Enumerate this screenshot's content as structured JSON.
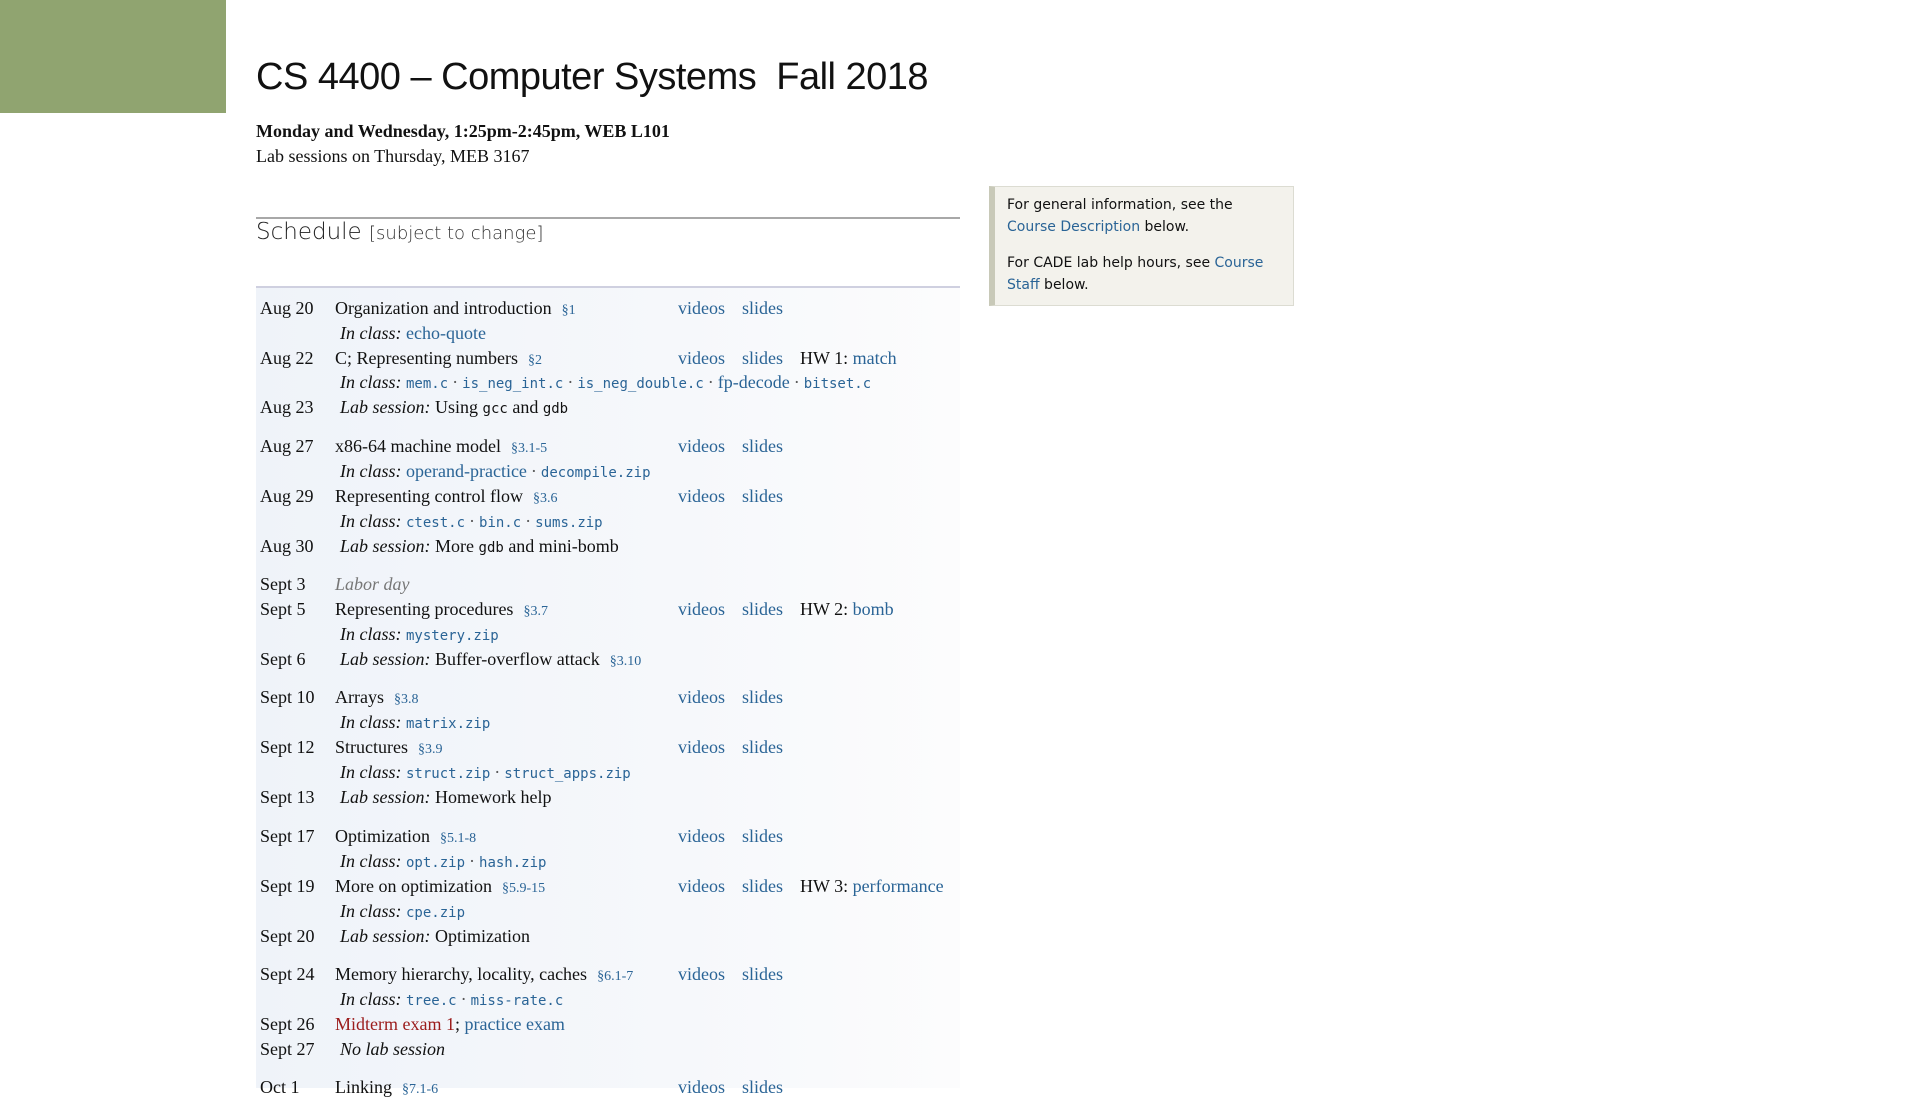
{
  "header": {
    "course_title": "CS 4400 – Computer Systems",
    "term": "Fall 2018",
    "meeting": "Monday and Wednesday, 1:25pm-2:45pm, WEB L101",
    "lab": "Lab sessions on Thursday, MEB 3167"
  },
  "schedule": {
    "heading": "Schedule",
    "subheading": "[subject to change]",
    "labels": {
      "in_class": "In class:",
      "lab_session": "Lab session:",
      "videos": "videos",
      "slides": "slides",
      "sep": "·"
    },
    "rows": {
      "aug20": {
        "date": "Aug 20",
        "topic": "Organization and introduction",
        "section": "§1",
        "in_class": [
          "echo-quote"
        ]
      },
      "aug22": {
        "date": "Aug 22",
        "topic": "C; Representing numbers",
        "section": "§2",
        "hw_label": "HW 1:",
        "hw_link": "match",
        "in_class": [
          "mem.c",
          "is_neg_int.c",
          "is_neg_double.c",
          "fp-decode",
          "bitset.c"
        ]
      },
      "aug23": {
        "date": "Aug 23",
        "lab_pre": "Using ",
        "lab_code1": "gcc",
        "lab_mid": " and ",
        "lab_code2": "gdb"
      },
      "aug27": {
        "date": "Aug 27",
        "topic": "x86-64 machine model",
        "section": "§3.1-5",
        "in_class": [
          "operand-practice",
          "decompile.zip"
        ]
      },
      "aug29": {
        "date": "Aug 29",
        "topic": "Representing control flow",
        "section": "§3.6",
        "in_class": [
          "ctest.c",
          "bin.c",
          "sums.zip"
        ]
      },
      "aug30": {
        "date": "Aug 30",
        "lab_pre": "More ",
        "lab_code1": "gdb",
        "lab_post": " and mini-bomb"
      },
      "sep3": {
        "date": "Sept 3",
        "note": "Labor day"
      },
      "sep5": {
        "date": "Sept 5",
        "topic": "Representing procedures",
        "section": "§3.7",
        "hw_label": "HW 2:",
        "hw_link": "bomb",
        "in_class": [
          "mystery.zip"
        ]
      },
      "sep6": {
        "date": "Sept 6",
        "lab_text": "Buffer-overflow attack",
        "section": "§3.10"
      },
      "sep10": {
        "date": "Sept 10",
        "topic": "Arrays",
        "section": "§3.8",
        "in_class": [
          "matrix.zip"
        ]
      },
      "sep12": {
        "date": "Sept 12",
        "topic": "Structures",
        "section": "§3.9",
        "in_class": [
          "struct.zip",
          "struct_apps.zip"
        ]
      },
      "sep13": {
        "date": "Sept 13",
        "lab_text": "Homework help"
      },
      "sep17": {
        "date": "Sept 17",
        "topic": "Optimization",
        "section": "§5.1-8",
        "in_class": [
          "opt.zip",
          "hash.zip"
        ]
      },
      "sep19": {
        "date": "Sept 19",
        "topic": "More on optimization",
        "section": "§5.9-15",
        "hw_label": "HW 3:",
        "hw_link": "performance",
        "in_class": [
          "cpe.zip"
        ]
      },
      "sep20": {
        "date": "Sept 20",
        "lab_text": "Optimization"
      },
      "sep24": {
        "date": "Sept 24",
        "topic": "Memory hierarchy, locality, caches",
        "section": "§6.1-7",
        "in_class": [
          "tree.c",
          "miss-rate.c"
        ]
      },
      "sep26": {
        "date": "Sept 26",
        "exam": "Midterm exam 1",
        "exam_sep": ";",
        "practice": "practice exam"
      },
      "sep27": {
        "date": "Sept 27",
        "note": "No lab session"
      },
      "oct1": {
        "date": "Oct 1",
        "topic": "Linking",
        "section": "§7.1-6"
      }
    }
  },
  "info_box": {
    "line1_pre": "For general information, see the ",
    "line1_link": "Course Description",
    "line1_post": " below.",
    "line2_pre": "For CADE lab help hours, see ",
    "line2_link": "Course Staff",
    "line2_post": " below."
  },
  "colors": {
    "accent_green": "#90a470",
    "link_blue": "#2a6496",
    "exam_red": "#9b1c1c"
  }
}
